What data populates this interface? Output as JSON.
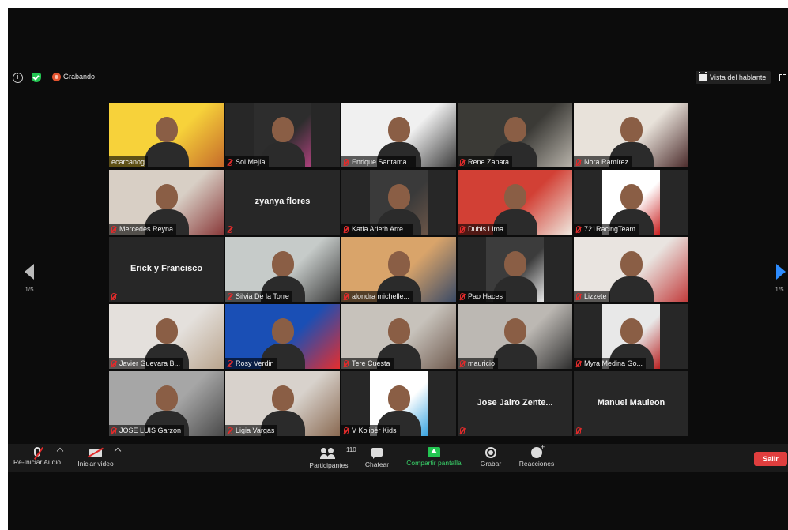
{
  "top_bar": {
    "recording_label": "Grabando",
    "view_button": "Vista del hablante",
    "icons": [
      "info-icon",
      "shield-check-icon",
      "record-icon",
      "speaker-view-icon",
      "fullscreen-icon"
    ]
  },
  "colors": {
    "accent_blue": "#2d8cff",
    "recording_orange": "#e4542f",
    "leave_red": "#e03e3e",
    "share_green": "#23c552",
    "active_speaker": "#f0e54b"
  },
  "pagination": {
    "left": "1/5",
    "right": "1/5"
  },
  "participants": [
    {
      "name": "ecarcanog",
      "video": true,
      "muted": false,
      "active": true
    },
    {
      "name": "Sol Mejía",
      "video": true,
      "muted": true
    },
    {
      "name": "Enrique Santama...",
      "video": true,
      "muted": true
    },
    {
      "name": "Rene Zapata",
      "video": true,
      "muted": true
    },
    {
      "name": "Nora Ramírez",
      "video": true,
      "muted": true
    },
    {
      "name": "Mercedes Reyna",
      "video": true,
      "muted": true
    },
    {
      "name": "zyanya flores",
      "video": false,
      "muted": true
    },
    {
      "name": "Katia Arleth Arre...",
      "video": true,
      "muted": true
    },
    {
      "name": "Dubis Lima",
      "video": true,
      "muted": true
    },
    {
      "name": "721RacingTeam",
      "video": true,
      "muted": true
    },
    {
      "name": "Erick y Francisco",
      "video": false,
      "muted": true
    },
    {
      "name": "Silvia De la Torre",
      "video": true,
      "muted": true
    },
    {
      "name": "alondra michelle...",
      "video": true,
      "muted": true
    },
    {
      "name": "Pao Haces",
      "video": true,
      "muted": true
    },
    {
      "name": "Lizzete",
      "video": true,
      "muted": true
    },
    {
      "name": "Javier Guevara B...",
      "video": true,
      "muted": true
    },
    {
      "name": "Rosy Verdin",
      "video": true,
      "muted": true
    },
    {
      "name": "Tere Cuesta",
      "video": true,
      "muted": true
    },
    {
      "name": "mauricio",
      "video": true,
      "muted": true
    },
    {
      "name": "Myra Medina Go...",
      "video": true,
      "muted": true
    },
    {
      "name": "JOSE LUIS Garzon",
      "video": true,
      "muted": true
    },
    {
      "name": "Ligia Vargas",
      "video": true,
      "muted": true
    },
    {
      "name": "V Kolibër Kids",
      "video": true,
      "muted": true
    },
    {
      "name": "Jose Jairo Zente...",
      "video": false,
      "muted": true
    },
    {
      "name": "Manuel Mauleon",
      "video": false,
      "muted": true
    }
  ],
  "toolbar": {
    "audio": "Re-Iniciar Audio",
    "video": "Iniciar video",
    "participants": "Participantes",
    "participants_count": "110",
    "chat": "Chatear",
    "share": "Compartir pantalla",
    "record": "Grabar",
    "reactions": "Reacciones",
    "leave": "Salir"
  }
}
